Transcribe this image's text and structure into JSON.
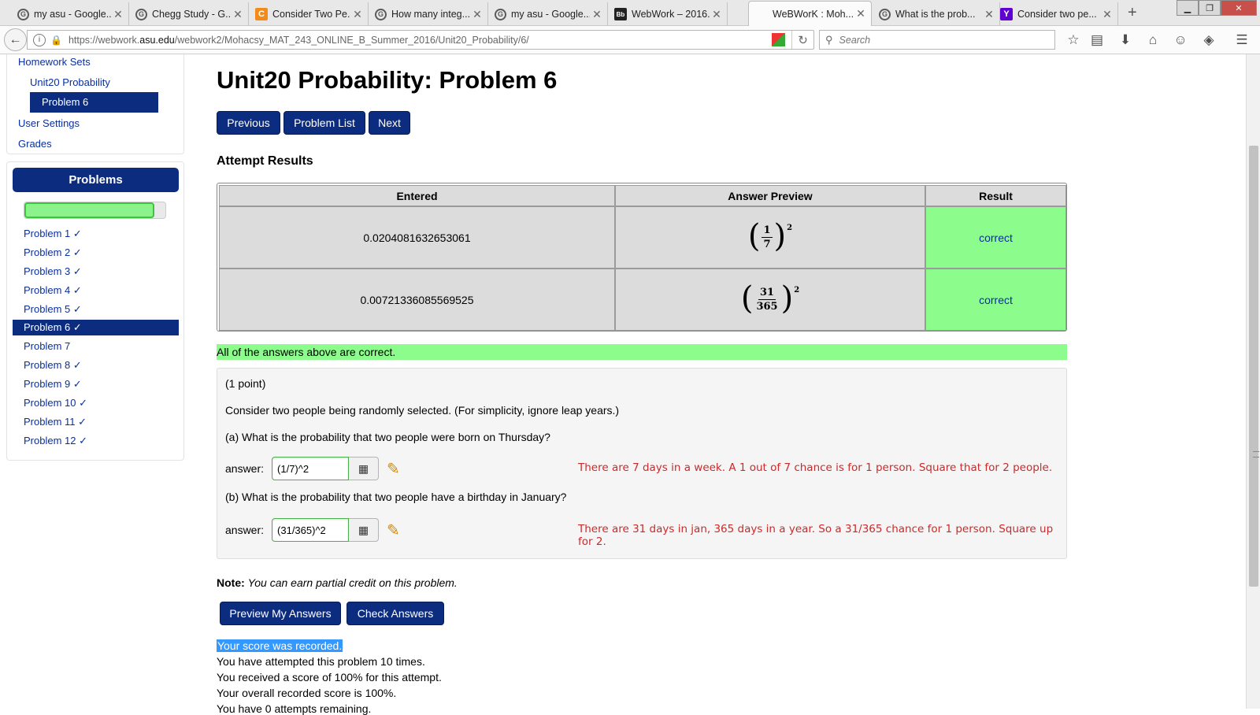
{
  "browser": {
    "tabs": [
      {
        "title": "my asu - Google...",
        "icon": "google-icon"
      },
      {
        "title": "Chegg Study - G...",
        "icon": "google-icon"
      },
      {
        "title": "Consider Two Pe...",
        "icon": "chegg-icon"
      },
      {
        "title": "How many integ...",
        "icon": "google-icon"
      },
      {
        "title": "my asu - Google...",
        "icon": "google-icon"
      },
      {
        "title": "WebWork – 2016...",
        "icon": "blackboard-icon"
      },
      {
        "title": "WeBWorK : Moh...",
        "icon": "none"
      },
      {
        "title": "What is the prob...",
        "icon": "google-icon"
      },
      {
        "title": "Consider two pe...",
        "icon": "yahoo-icon"
      }
    ],
    "active_tab_index": 6,
    "url_prefix": "https://webwork.",
    "url_domain": "asu.edu",
    "url_path": "/webwork2/Mohacsy_MAT_243_ONLINE_B_Summer_2016/Unit20_Probability/6/",
    "search_placeholder": "Search"
  },
  "sidebar": {
    "homework_sets": "Homework Sets",
    "set_name": "Unit20 Probability",
    "current_problem": "Problem 6",
    "user_settings": "User Settings",
    "grades": "Grades",
    "problems_header": "Problems",
    "progress_fraction": 0.92,
    "problems": [
      {
        "label": "Problem 1 ✓",
        "current": false
      },
      {
        "label": "Problem 2 ✓",
        "current": false
      },
      {
        "label": "Problem 3 ✓",
        "current": false
      },
      {
        "label": "Problem 4 ✓",
        "current": false
      },
      {
        "label": "Problem 5 ✓",
        "current": false
      },
      {
        "label": "Problem 6 ✓",
        "current": true
      },
      {
        "label": "Problem 7",
        "current": false
      },
      {
        "label": "Problem 8 ✓",
        "current": false
      },
      {
        "label": "Problem 9 ✓",
        "current": false
      },
      {
        "label": "Problem 10 ✓",
        "current": false
      },
      {
        "label": "Problem 11 ✓",
        "current": false
      },
      {
        "label": "Problem 12 ✓",
        "current": false
      }
    ]
  },
  "main": {
    "title": "Unit20 Probability: Problem 6",
    "nav": {
      "previous": "Previous",
      "problem_list": "Problem List",
      "next": "Next"
    },
    "attempt_results_heading": "Attempt Results",
    "results_table": {
      "headers": [
        "Entered",
        "Answer Preview",
        "Result"
      ],
      "rows": [
        {
          "entered": "0.0204081632653061",
          "preview_num": "1",
          "preview_den": "7",
          "preview_exp": "2",
          "result": "correct"
        },
        {
          "entered": "0.00721336085569525",
          "preview_num": "31",
          "preview_den": "365",
          "preview_exp": "2",
          "result": "correct"
        }
      ]
    },
    "all_correct_message": "All of the answers above are correct.",
    "problem": {
      "points": "(1 point)",
      "statement": "Consider two people being randomly selected. (For simplicity, ignore leap years.)",
      "part_a": "(a)  What is the probability that two people were born on Thursday?",
      "part_b": "(b)  What is the probability that two people have a birthday in January?",
      "answer_label": "answer:",
      "answer_a": "(1/7)^2",
      "answer_b": "(31/365)^2",
      "hint_a": "There are 7 days in a week. A 1 out of 7 chance is for 1 person. Square that for 2 people.",
      "hint_b": "There are 31 days in jan, 365 days in a year. So a 31/365 chance for 1 person. Square up for 2."
    },
    "note_label": "Note:",
    "note_text": "You can earn partial credit on this problem.",
    "buttons": {
      "preview": "Preview My Answers",
      "check": "Check Answers"
    },
    "score_messages": [
      "Your score was recorded.",
      "You have attempted this problem 10 times.",
      "You received a score of 100% for this attempt.",
      "Your overall recorded score is 100%.",
      "You have 0 attempts remaining."
    ]
  },
  "colors": {
    "brand_navy": "#0c2c80",
    "link_blue": "#0a2f9e",
    "correct_green": "#8cfc8c",
    "hint_red": "#cc2a2a",
    "selection_blue": "#3399ff"
  }
}
